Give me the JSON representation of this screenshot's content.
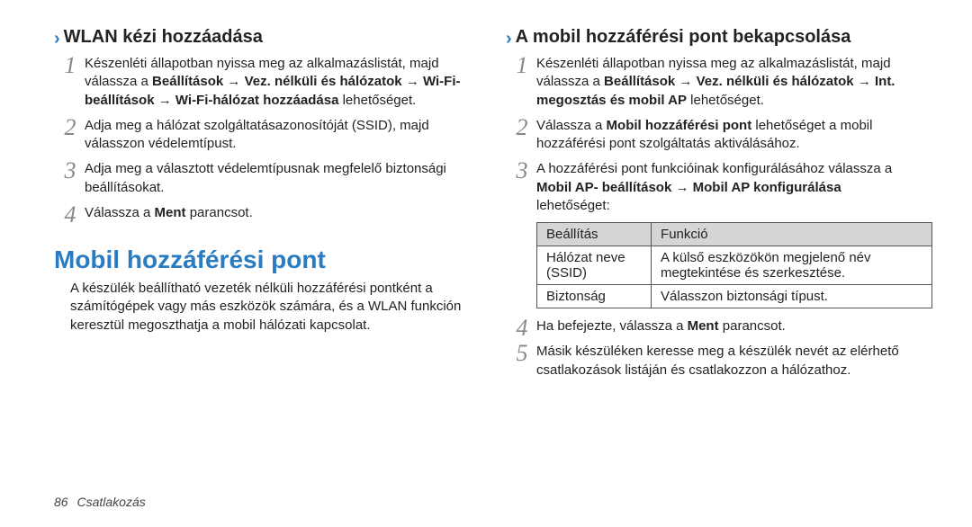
{
  "left": {
    "h3": "WLAN kézi hozzáadása",
    "steps": [
      {
        "pre": "Készenléti állapotban nyissa meg az alkalmazáslistát, majd válassza a ",
        "bold": "Beállítások → Vez. nélküli és hálózatok → Wi-Fi-beállítások → Wi-Fi-hálózat hozzáadása",
        "post": " lehetőséget."
      },
      {
        "pre": "Adja meg a hálózat szolgáltatásazonosítóját (SSID), majd válasszon védelemtípust.",
        "bold": "",
        "post": ""
      },
      {
        "pre": "Adja meg a választott védelemtípusnak megfelelő biztonsági beállításokat.",
        "bold": "",
        "post": ""
      },
      {
        "pre": "Válassza a ",
        "bold": "Ment",
        "post": " parancsot."
      }
    ],
    "h2": "Mobil hozzáférési pont",
    "para": "A készülék beállítható vezeték nélküli hozzáférési pontként a számítógépek vagy más eszközök számára, és a WLAN funkción keresztül megoszthatja a mobil hálózati kapcsolat."
  },
  "right": {
    "h3": "A mobil hozzáférési pont bekapcsolása",
    "steps": [
      {
        "pre": "Készenléti állapotban nyissa meg az alkalmazáslistát, majd válassza a ",
        "bold": "Beállítások → Vez. nélküli és hálózatok → Int. megosztás és mobil AP",
        "post": " lehetőséget."
      },
      {
        "pre": "Válassza a ",
        "bold": "Mobil hozzáférési pont",
        "post": " lehetőséget a mobil hozzáférési pont szolgáltatás aktiválásához."
      },
      {
        "pre": "A hozzáférési pont funkcióinak konfigurálásához válassza a ",
        "bold": "Mobil AP- beállítások → Mobil AP konfigurálása",
        "post": " lehetőséget:"
      },
      {
        "pre": "Ha befejezte, válassza a ",
        "bold": "Ment",
        "post": " parancsot."
      },
      {
        "pre": "Másik készüléken keresse meg a készülék nevét az elérhető csatlakozások listáján és csatlakozzon a hálózathoz.",
        "bold": "",
        "post": ""
      }
    ],
    "table": {
      "head": [
        "Beállítás",
        "Funkció"
      ],
      "rows": [
        [
          "Hálózat neve (SSID)",
          "A külső eszközökön megjelenő név megtekintése és szerkesztése."
        ],
        [
          "Biztonság",
          "Válasszon biztonsági típust."
        ]
      ]
    }
  },
  "footer": {
    "page": "86",
    "section": "Csatlakozás"
  }
}
